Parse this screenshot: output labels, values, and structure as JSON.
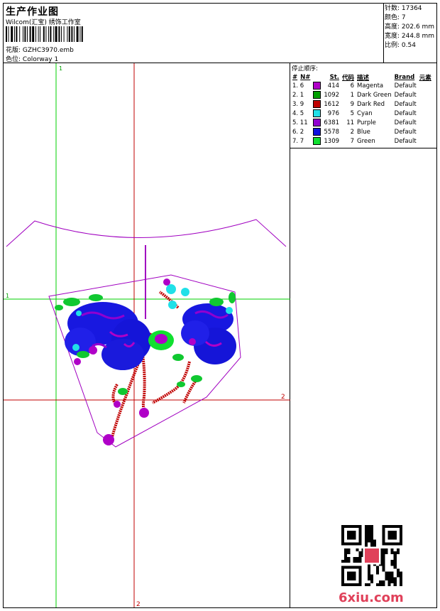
{
  "header": {
    "title": "生产作业图",
    "company": "Wilcom(汇宝) 绣饰工作室",
    "design_label": "花版: ",
    "design_value": "GZHC3970.emb",
    "colorway_label": "色位: ",
    "colorway_value": "Colorway 1"
  },
  "info": {
    "stitches_label": "针数: ",
    "stitches_value": "17364",
    "colors_label": "颜色: ",
    "colors_value": "7",
    "height_label": "高度: ",
    "height_value": "202.6 mm",
    "width_label": "宽度: ",
    "width_value": "244.8 mm",
    "scale_label": "比例: ",
    "scale_value": "0.54"
  },
  "canvas": {
    "v1_label": "1",
    "h1_label": "1",
    "h2_label": "2",
    "v2_label": "2"
  },
  "stop_sequence": {
    "title": "停止顺序:",
    "headers": [
      "#",
      "N#",
      "St.",
      "代码",
      "描述",
      "Brand",
      "元素"
    ],
    "rows": [
      {
        "idx": "1. 6",
        "color": "#b000c8",
        "st": "414",
        "code": "6",
        "desc": "Magenta",
        "brand": "Default"
      },
      {
        "idx": "2. 1",
        "color": "#00a000",
        "st": "1092",
        "code": "1",
        "desc": "Dark Green",
        "brand": "Default"
      },
      {
        "idx": "3. 9",
        "color": "#c00000",
        "st": "1612",
        "code": "9",
        "desc": "Dark Red",
        "brand": "Default"
      },
      {
        "idx": "4. 5",
        "color": "#20e0e8",
        "st": "976",
        "code": "5",
        "desc": "Cyan",
        "brand": "Default"
      },
      {
        "idx": "5. 11",
        "color": "#9000d0",
        "st": "6381",
        "code": "11",
        "desc": "Purple",
        "brand": "Default"
      },
      {
        "idx": "6. 2",
        "color": "#1010e0",
        "st": "5578",
        "code": "2",
        "desc": "Blue",
        "brand": "Default"
      },
      {
        "idx": "7. 7",
        "color": "#10e030",
        "st": "1309",
        "code": "7",
        "desc": "Green",
        "brand": "Default"
      }
    ]
  },
  "watermark": "6xiu.com",
  "colors": {
    "guide_green": "#00d000",
    "guide_red": "#c00000",
    "outline_purple": "#a000c0"
  }
}
